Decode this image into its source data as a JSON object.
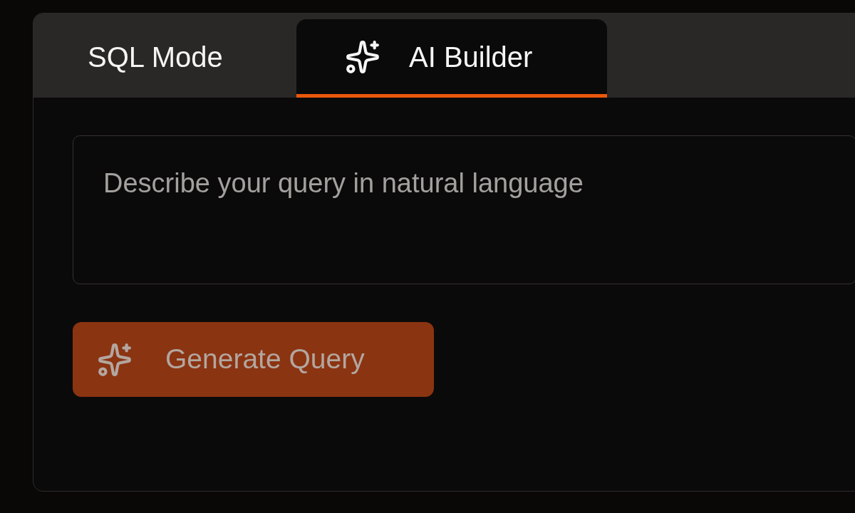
{
  "tabs": [
    {
      "label": "SQL Mode",
      "selected": false,
      "icon": false
    },
    {
      "label": "AI Builder",
      "selected": true,
      "icon": true
    }
  ],
  "query_field": {
    "placeholder": "Describe your query in natural language"
  },
  "generate_button": {
    "label": "Generate Query",
    "disabled": true
  }
}
